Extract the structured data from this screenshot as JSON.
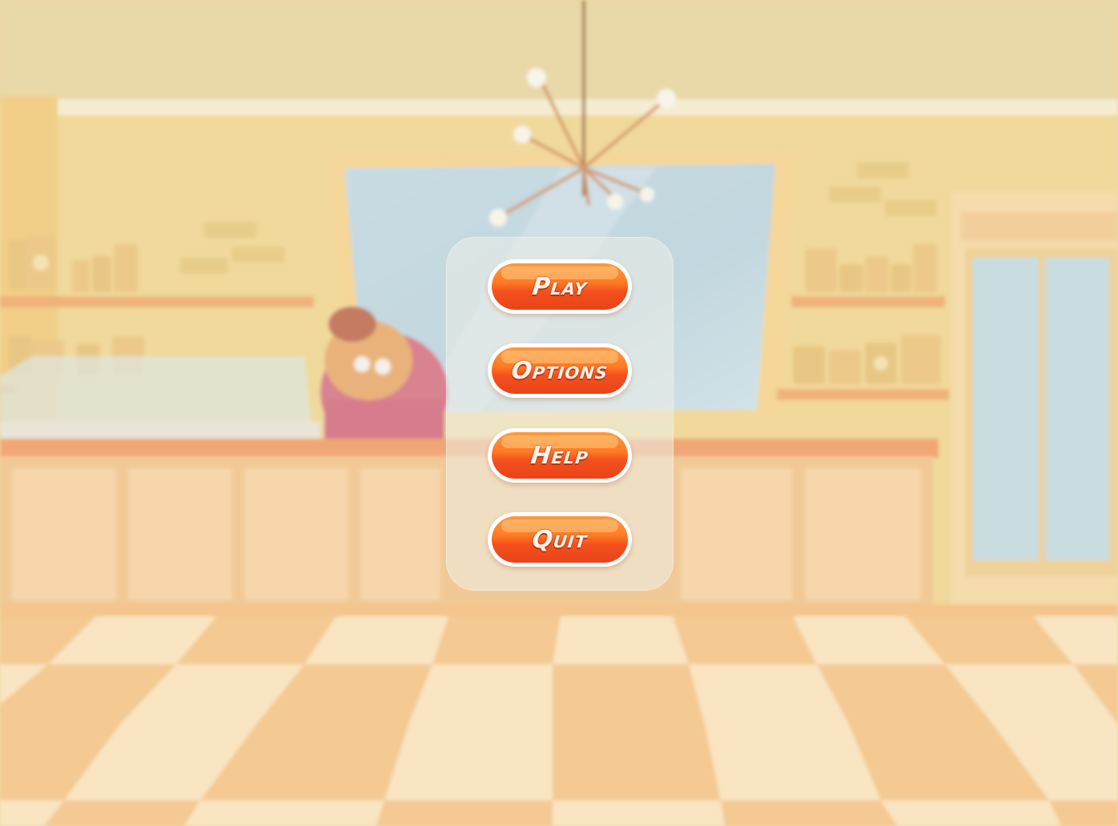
{
  "menu": {
    "buttons": [
      {
        "label": "Play"
      },
      {
        "label": "Options"
      },
      {
        "label": "Help"
      },
      {
        "label": "Quit"
      }
    ]
  },
  "colors": {
    "wall": "#f2dc95",
    "floor_light": "#f8e2bd",
    "floor_dark": "#f2c48c",
    "counter": "#f0c28c",
    "button_orange": "#f4511d",
    "button_border": "#ffffff"
  }
}
